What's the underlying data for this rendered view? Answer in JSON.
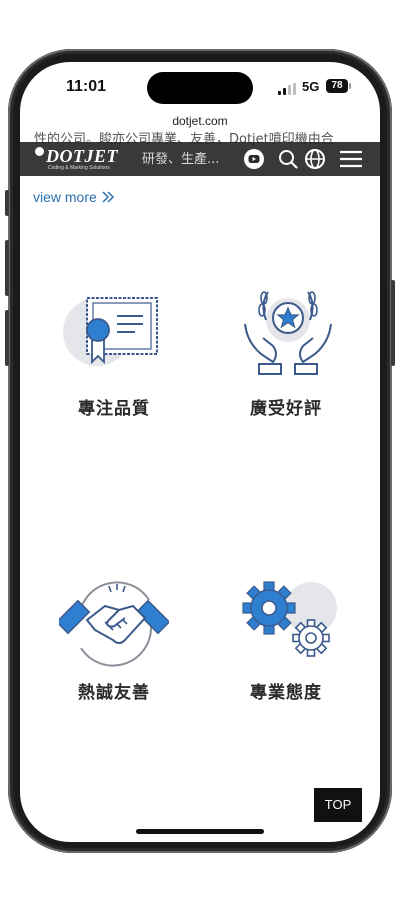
{
  "status_bar": {
    "time": "11:01",
    "network": "5G",
    "battery": "78"
  },
  "browser": {
    "url": "dotjet.com"
  },
  "page": {
    "partial_text_line1": "性的公司。睃亦公司專業、友善，Dotjet噴印機由合",
    "header_tail_text": "研發、生產...",
    "view_more": "view more",
    "view_more_icon": "double-chevron-right-icon"
  },
  "header": {
    "logo_text": "DOTJET",
    "logo_tagline": "Coding & Marking Solutions",
    "icons": [
      "youtube-icon",
      "search-icon",
      "globe-icon",
      "menu-icon"
    ]
  },
  "features": [
    {
      "label": "專注品質",
      "icon": "certificate-icon"
    },
    {
      "label": "廣受好評",
      "icon": "award-star-hands-icon"
    },
    {
      "label": "熱誠友善",
      "icon": "handshake-icon"
    },
    {
      "label": "專業態度",
      "icon": "gears-icon"
    }
  ],
  "top_button": "TOP",
  "colors": {
    "accent_blue": "#2f7fd1",
    "header_bg": "#2a2a2a",
    "link_blue": "#2a6fb0"
  }
}
